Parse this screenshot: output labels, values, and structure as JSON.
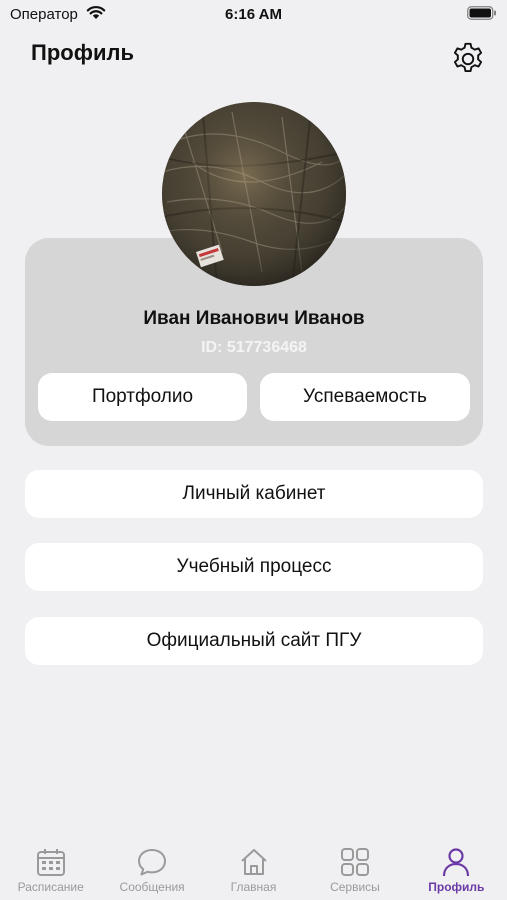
{
  "status_bar": {
    "carrier": "Оператор",
    "time": "6:16 AM"
  },
  "header": {
    "title": "Профиль",
    "settings_icon": "gear-icon"
  },
  "profile": {
    "full_name": "Иван Иванович Иванов",
    "id_text": "ID: 517736468",
    "buttons": {
      "portfolio": "Портфолио",
      "performance": "Успеваемость"
    }
  },
  "links": [
    {
      "label": "Личный кабинет"
    },
    {
      "label": "Учебный процесс"
    },
    {
      "label": "Официальный сайт ПГУ"
    }
  ],
  "tabs": [
    {
      "label": "Расписание",
      "icon": "calendar-icon",
      "active": false
    },
    {
      "label": "Сообщения",
      "icon": "chat-bubble-icon",
      "active": false
    },
    {
      "label": "Главная",
      "icon": "home-icon",
      "active": false
    },
    {
      "label": "Сервисы",
      "icon": "services-grid-icon",
      "active": false
    },
    {
      "label": "Профиль",
      "icon": "person-icon",
      "active": true
    }
  ],
  "colors": {
    "accent": "#6b3aa6",
    "inactive": "#9a9a9a",
    "card": "#d6d6d6",
    "background": "#f0f0f2"
  }
}
